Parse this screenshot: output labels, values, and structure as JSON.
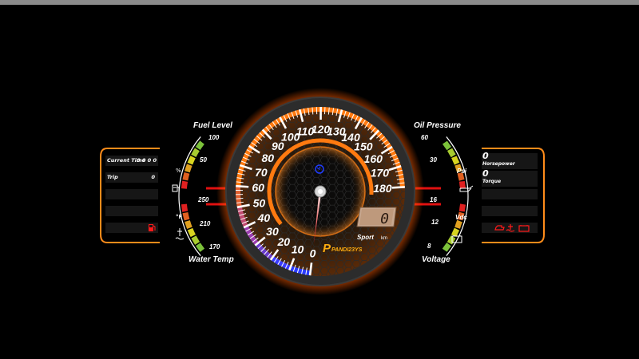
{
  "colors": {
    "accent": "#ff7a10",
    "panel_frame": "#ff8c1a",
    "warning_red": "#ff1a1a",
    "low_blue": "#2a3cff",
    "gauge_green": "#7cc23a",
    "gauge_yellow": "#e6d420"
  },
  "speedometer": {
    "tick_labels": [
      "0",
      "10",
      "20",
      "30",
      "40",
      "50",
      "60",
      "70",
      "80",
      "90",
      "100",
      "110",
      "120",
      "130",
      "140",
      "150",
      "160",
      "170",
      "180"
    ],
    "speed_value": "0",
    "mode": "Sport",
    "unit": "km",
    "brand": "PANDI23YS",
    "needle_value": 0
  },
  "left_panel": {
    "current_time_label": "Current Time",
    "current_time_value": "0  0  0  0",
    "trip_label": "Trip",
    "trip_value": "0"
  },
  "right_panel": {
    "horsepower_value": "0",
    "horsepower_label": "Horsepower",
    "torque_value": "0",
    "torque_label": "Torque"
  },
  "fuel": {
    "label": "Fuel Level",
    "max": "100",
    "mid": "50",
    "unit": "%",
    "level": 0.0
  },
  "water": {
    "label": "Water Temp",
    "top": "250",
    "mid": "210",
    "bottom": "170",
    "unit": "°F",
    "level": 0.0
  },
  "oil": {
    "label": "Oil Pressure",
    "top": "60",
    "mid": "30",
    "unit": "Psi",
    "level": 0.0
  },
  "voltage": {
    "label": "Voltage",
    "top": "16",
    "mid": "12",
    "bottom": "8",
    "unit": "Vdc",
    "level": 0.0
  },
  "icons": [
    "fuel-pump-icon",
    "fuel-warning-icon",
    "coolant-temp-icon",
    "oil-can-icon",
    "battery-icon",
    "engine-warning-icon",
    "cruise-icon"
  ]
}
